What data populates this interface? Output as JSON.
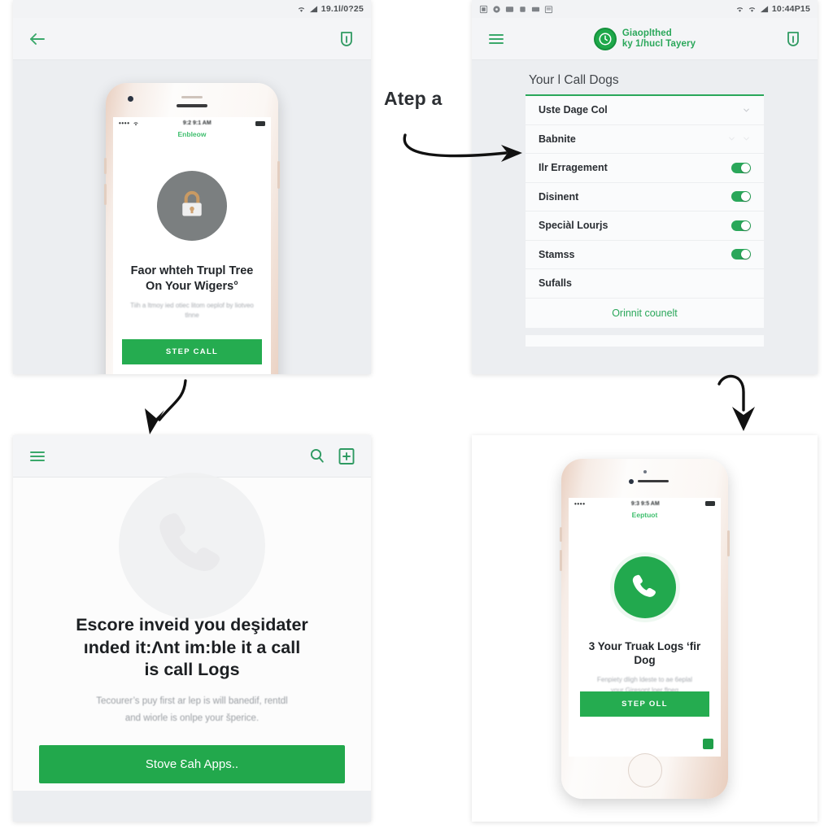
{
  "theme": {
    "brand_green": "#22a94e",
    "accent_green": "#2aa75a",
    "panel_bg": "#eceef1",
    "page_bg": "#ffffff",
    "text_dark": "#1c1f22"
  },
  "flow_label": "Atep a",
  "panel1": {
    "name": "step-one-panel",
    "statusbar": {
      "clock": "19.1l/0?25",
      "wifi_icon": "wifi-icon",
      "signal_icon": "signal-icon"
    },
    "appbar": {
      "back_icon": "back-arrow-icon",
      "action_icon": "bookmark-icon"
    },
    "phone": {
      "ios_status": {
        "dots": "••••",
        "wifi_icon": "wifi-icon",
        "time": "9:2 9:1 AM",
        "battery_icon": "battery-icon"
      },
      "carrier_label": "Enbleow",
      "hero_icon": "lock-icon",
      "title_line1": "Faor whteh Trupl Tree",
      "title_line2": "On Your Wigers°",
      "subtitle": "Tiih a ltmoy ied otiec litom oeplof by liotveo tlnne",
      "cta_label": "STEP CALL"
    }
  },
  "panel2": {
    "name": "settings-list-panel",
    "statusbar": {
      "clock": "10:44P15",
      "notification_icons": [
        "screenshot-icon",
        "sync-icon",
        "mail-icon",
        "download-icon",
        "video-icon",
        "calendar-icon"
      ],
      "wifi_icon": "wifi-icon",
      "wifi2_icon": "wifi-icon",
      "signal_icon": "signal-icon"
    },
    "appbar": {
      "menu_icon": "hamburger-menu-icon",
      "brand_line1": "Giaoplthed",
      "brand_line2": "ky 1/hucl Tayery",
      "logo_icon": "clock-logo-icon",
      "action_icon": "bookmark-icon"
    },
    "section_title": "Your l Call Dogs",
    "rows": [
      {
        "label": "Uste Dage Col",
        "control": "chevron-down-icon"
      },
      {
        "label": "Babnite",
        "control": "double-chevron-icon"
      },
      {
        "label": "Ilr Erragement",
        "control": "toggle-on"
      },
      {
        "label": "Disinent",
        "control": "toggle-on"
      },
      {
        "label": "Speciàl Lourjs",
        "control": "toggle-on"
      },
      {
        "label": "Stamss",
        "control": "toggle-on"
      },
      {
        "label": "Sufalls",
        "control": "none"
      }
    ],
    "footer_link": "Orinnit counelt"
  },
  "panel3": {
    "name": "empty-state-panel",
    "appbar": {
      "menu_icon": "hamburger-menu-icon",
      "search_icon": "search-icon",
      "add_note_icon": "add-document-icon"
    },
    "ghost_icon": "phone-call-icon",
    "title_line1": "Escore inveid you deşidater",
    "title_line2": "ınded it:Λnt im:ble it a call",
    "title_line3": "is call Logs",
    "subtitle_line1": "Tecourer’s puy first ar lep is will banedif, rentdl",
    "subtitle_line2": "and wiorle is onlpe your šperice.",
    "cta_label": "Stove Ɛah Apps.."
  },
  "panel4": {
    "name": "step-three-panel",
    "phone": {
      "ios_status": {
        "dots": "••••",
        "time": "9:3 9:5 AM",
        "battery_icon": "battery-icon"
      },
      "carrier_label": "Eeptuot",
      "hero_icon": "phone-call-icon",
      "title": "3 Your Truak Logs ʻfir Dog",
      "subtitle_line1": "Fenpiety dligh ldeste to ae 6eplal",
      "subtitle_line2": "your Giresont loer flneg",
      "cta_label": "STEP OLL",
      "corner_badge_icon": "app-badge-icon"
    }
  }
}
